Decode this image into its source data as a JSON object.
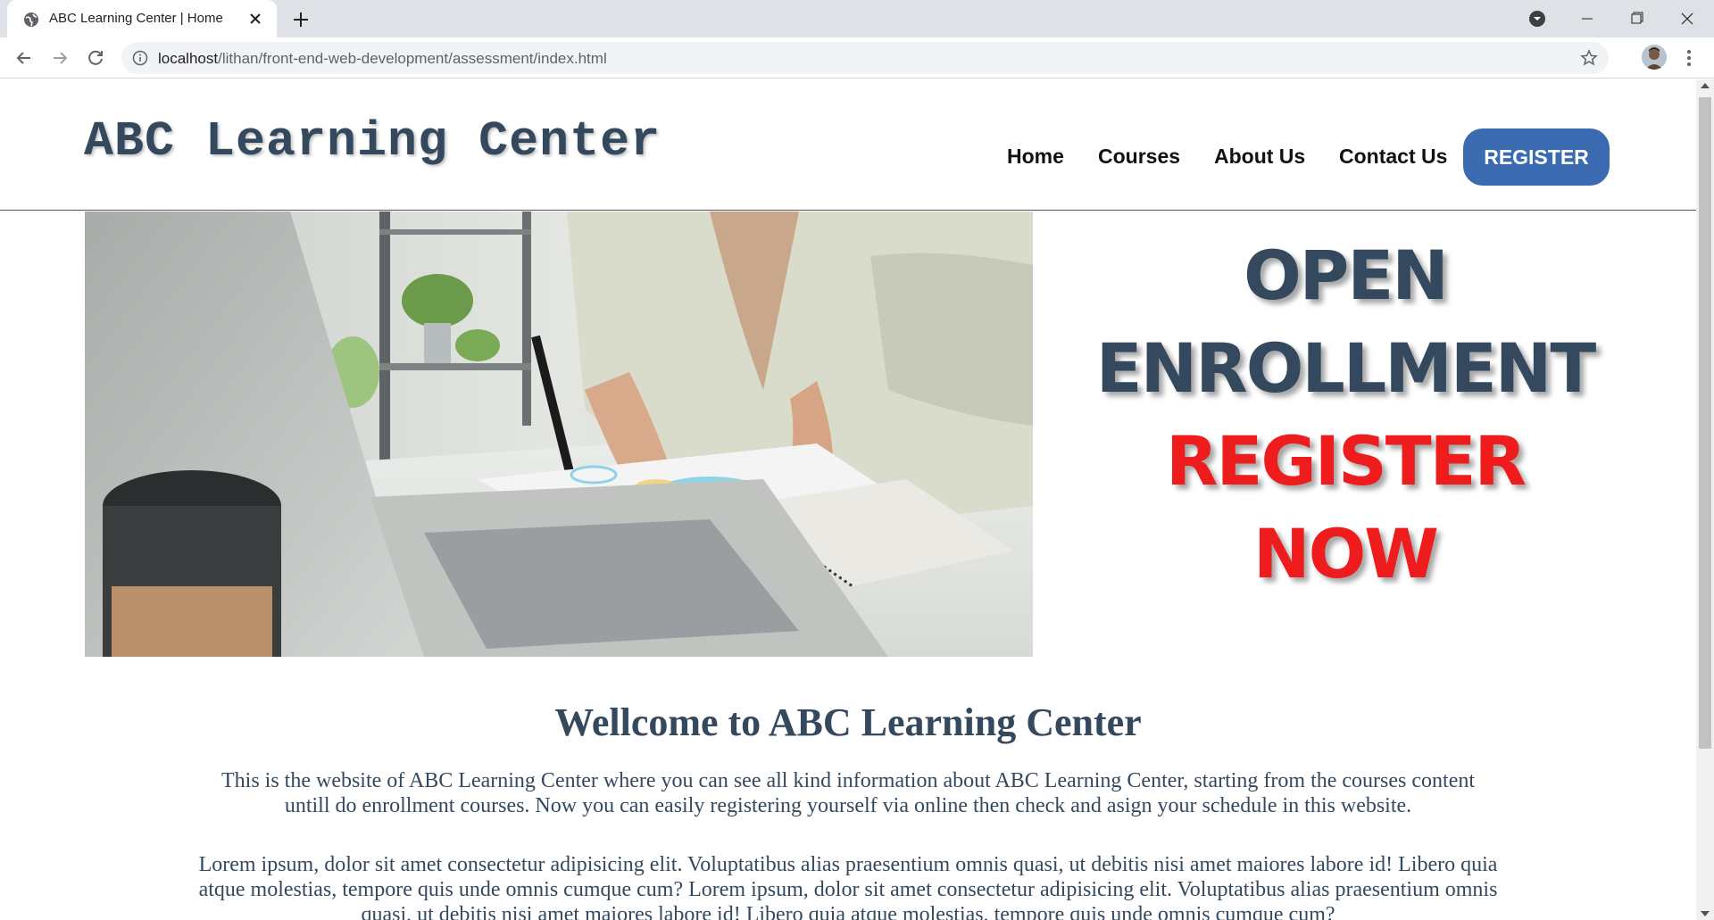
{
  "browser": {
    "tab_title": "ABC Learning Center | Home",
    "url_host": "localhost",
    "url_path": "/lithan/front-end-web-development/assessment/index.html"
  },
  "site": {
    "logo": "ABC Learning Center",
    "nav": {
      "home": "Home",
      "courses": "Courses",
      "about": "About Us",
      "contact": "Contact Us"
    },
    "register_button": "REGISTER"
  },
  "hero": {
    "promo_line1": "OPEN",
    "promo_line2": "ENROLLMENT",
    "promo_line3": "REGISTER",
    "promo_line4": "NOW"
  },
  "content": {
    "title": "Wellcome to ABC Learning Center",
    "intro": "This is the website of ABC Learning Center where you can see all kind information about ABC Learning Center, starting from the courses content untill do enrollment courses. Now you can easily registering yourself via online then check and asign your schedule in this website.",
    "lorem": "Lorem ipsum, dolor sit amet consectetur adipisicing elit. Voluptatibus alias praesentium omnis quasi, ut debitis nisi amet maiores labore id! Libero quia atque molestias, tempore quis unde omnis cumque cum? Lorem ipsum, dolor sit amet consectetur adipisicing elit. Voluptatibus alias praesentium omnis quasi, ut debitis nisi amet maiores labore id! Libero quia atque molestias, tempore quis unde omnis cumque cum?"
  },
  "colors": {
    "brand_dark": "#34495e",
    "register_button": "#3a6ab0",
    "accent_red": "#ee1c1c"
  },
  "icons": [
    "globe-icon",
    "close-icon",
    "plus-icon",
    "tab-search-icon",
    "minimize-icon",
    "maximize-icon",
    "window-close-icon",
    "back-icon",
    "forward-icon",
    "reload-icon",
    "info-icon",
    "star-icon",
    "avatar",
    "kebab-menu-icon"
  ]
}
